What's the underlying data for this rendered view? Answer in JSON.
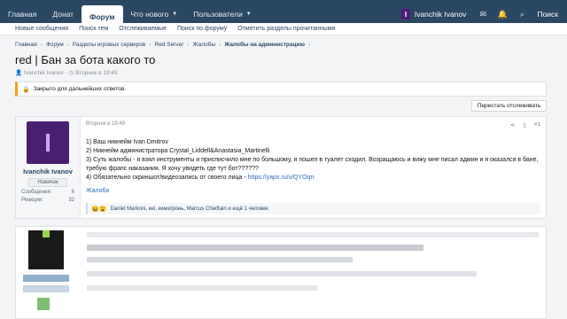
{
  "topnav": {
    "items": [
      "Главная",
      "Донат",
      "Форум",
      "Что нового",
      "Пользователи"
    ],
    "user": "Ivanchik Ivanov",
    "search": "Поиск"
  },
  "subnav": [
    "Новые сообщения",
    "Поиск тем",
    "Отслеживаемые",
    "Поиск по форуму",
    "Отметить разделы прочитанными"
  ],
  "breadcrumbs": [
    "Главная",
    "Форум",
    "Разделы игровых серверов",
    "Red Server",
    "Жалобы",
    "Жалобы на администрацию"
  ],
  "thread": {
    "title": "red | Бан за бота какого то",
    "author": "Ivanchik Ivanov",
    "date": "Вторник в 19:49",
    "locked_text": "Закрыто для дальнейших ответов.",
    "follow_label": "Перестать отслеживать"
  },
  "post": {
    "user": "Ivanchik Ivanov",
    "rank": "Новичок",
    "messages_label": "Сообщения:",
    "messages": "6",
    "reactions_label": "Реакции:",
    "reactions": "32",
    "date": "Вторник в 19:49",
    "number": "#1",
    "lines": [
      "1) Ваш никнейм Ivan Dmitrov",
      "2) Никнейм администратора Crystal_Liddell&Anastasia_Martinelli",
      "3) Суть жалобы - я взял инструменты и присписчило мне по большому, я пошел в туалет сходил. Возращаюсь и вижу мне писал админ и я оказался в бане, требую фрапс наказания. Я хочу увидеть где тут бот??????",
      "4) Обязательно скриншот/видеозапись от своего лица - "
    ],
    "link": "https://yapx.ru/v/QYOqn",
    "complaint_link": "Жалоба",
    "reactions_text": "Daniel Markoni, кel, кемэтронь, Marcus Chieftain и ещё 1 человек"
  }
}
